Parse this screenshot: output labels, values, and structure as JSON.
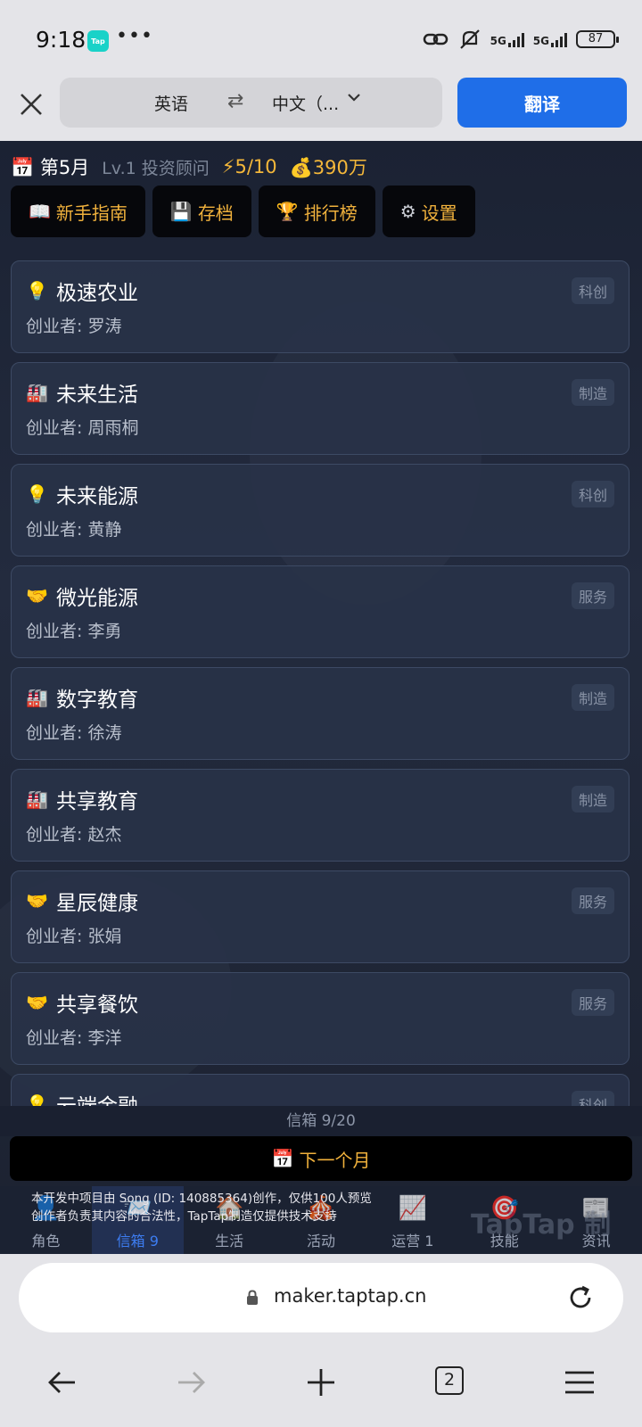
{
  "status_bar": {
    "time": "9:18",
    "app_badge": "Tap",
    "more": "•••",
    "signal_1": "5G",
    "signal_2": "5G",
    "battery": "87"
  },
  "translate_bar": {
    "source_lang": "英语",
    "swap_icon": "⇄",
    "target_lang": "中文（...",
    "translate_label": "翻译"
  },
  "game": {
    "month_icon": "📅",
    "month": "第5月",
    "level": "Lv.1 投资顾问",
    "energy": "⚡5/10",
    "money": "💰390万",
    "toolbar": [
      {
        "icon": "📖",
        "label": "新手指南"
      },
      {
        "icon": "💾",
        "label": "存档"
      },
      {
        "icon": "🏆",
        "label": "排行榜"
      },
      {
        "icon": "⚙",
        "label": "设置"
      }
    ],
    "cards": [
      {
        "icon": "💡",
        "name": "极速农业",
        "founder": "创业者: 罗涛",
        "tag": "科创"
      },
      {
        "icon": "🏭",
        "name": "未来生活",
        "founder": "创业者: 周雨桐",
        "tag": "制造"
      },
      {
        "icon": "💡",
        "name": "未来能源",
        "founder": "创业者: 黄静",
        "tag": "科创"
      },
      {
        "icon": "🤝",
        "name": "微光能源",
        "founder": "创业者: 李勇",
        "tag": "服务"
      },
      {
        "icon": "🏭",
        "name": "数字教育",
        "founder": "创业者: 徐涛",
        "tag": "制造"
      },
      {
        "icon": "🏭",
        "name": "共享教育",
        "founder": "创业者: 赵杰",
        "tag": "制造"
      },
      {
        "icon": "🤝",
        "name": "星辰健康",
        "founder": "创业者: 张娟",
        "tag": "服务"
      },
      {
        "icon": "🤝",
        "name": "共享餐饮",
        "founder": "创业者: 李洋",
        "tag": "服务"
      },
      {
        "icon": "💡",
        "name": "云端金融",
        "founder": "",
        "tag": "科创"
      }
    ],
    "mailbox_status": "信箱 9/20",
    "next_month_icon": "📅",
    "next_month_label": "下一个月",
    "notice_line1": "本开发中项目由 Song (ID: 140885364)创作，仅供100人预览",
    "notice_line2": "创作者负责其内容的合法性，TapTap制造仅提供技术支持",
    "watermark": "TapTap 制",
    "tabs": [
      {
        "icon": "👤",
        "label": "角色"
      },
      {
        "icon": "📨",
        "label": "信箱 9"
      },
      {
        "icon": "🏠",
        "label": "生活"
      },
      {
        "icon": "🎪",
        "label": "活动"
      },
      {
        "icon": "📈",
        "label": "运营 1"
      },
      {
        "icon": "🎯",
        "label": "技能"
      },
      {
        "icon": "📰",
        "label": "资讯"
      }
    ]
  },
  "browser": {
    "url": "maker.taptap.cn",
    "tab_count": "2"
  },
  "colors": {
    "accent_blue": "#1f6ee8",
    "gold": "#f0b13c",
    "card_bg": "#283248"
  }
}
